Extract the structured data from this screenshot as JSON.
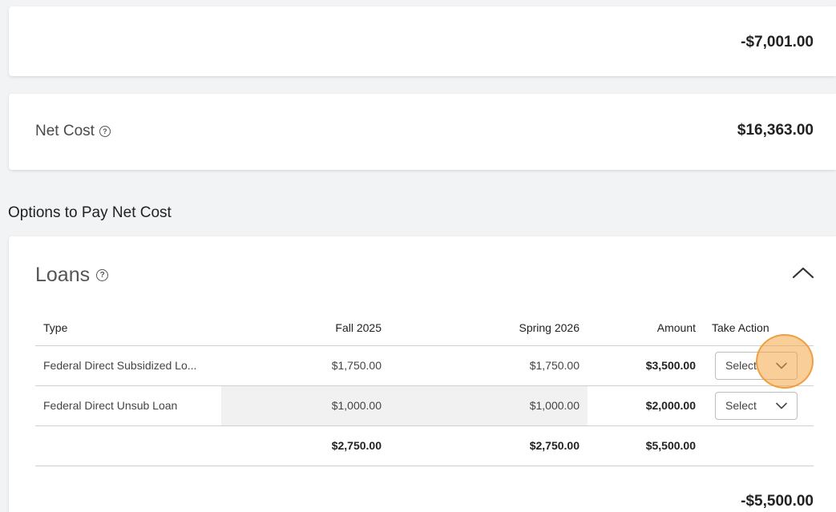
{
  "top_card": {
    "amount": "-$7,001.00"
  },
  "net_cost": {
    "label": "Net Cost",
    "amount": "$16,363.00"
  },
  "section_title": "Options to Pay Net Cost",
  "loans": {
    "title": "Loans",
    "headers": {
      "type": "Type",
      "fall": "Fall 2025",
      "spring": "Spring 2026",
      "amount": "Amount",
      "action": "Take Action"
    },
    "rows": [
      {
        "type": "Federal Direct Subsidized Lo...",
        "fall": "$1,750.00",
        "spring": "$1,750.00",
        "amount": "$3,500.00",
        "action": "Select"
      },
      {
        "type": "Federal Direct Unsub Loan",
        "fall": "$1,000.00",
        "spring": "$1,000.00",
        "amount": "$2,000.00",
        "action": "Select"
      }
    ],
    "totals": {
      "fall": "$2,750.00",
      "spring": "$2,750.00",
      "amount": "$5,500.00"
    },
    "net_total": "-$5,500.00"
  },
  "colors": {
    "background": "#f2f3f5",
    "card": "#ffffff",
    "highlight": "#f5a646"
  },
  "icons": {
    "help": "help-circle-icon",
    "collapse": "chevron-up-icon",
    "dropdown": "chevron-down-icon"
  }
}
